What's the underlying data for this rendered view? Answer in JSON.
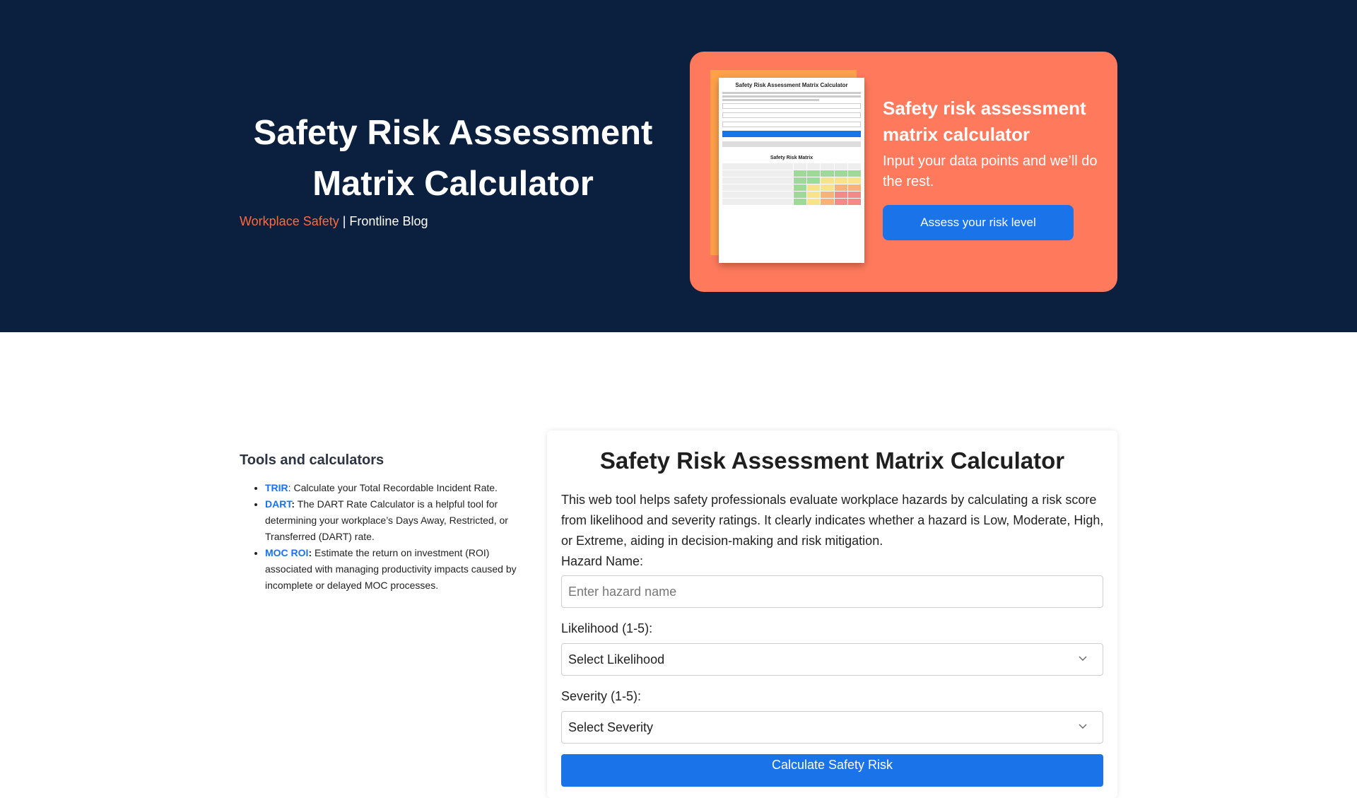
{
  "hero": {
    "title": "Safety Risk Assessment Matrix Calculator",
    "category": "Workplace Safety",
    "separator": " | ",
    "blog": "Frontline Blog"
  },
  "promo": {
    "doc_title": "Safety Risk Assessment Matrix Calculator",
    "doc_matrix_title": "Safety Risk Matrix",
    "title": "Safety risk assessment matrix calculator",
    "subtitle": "Input your data points and we’ll do the rest.",
    "button": "Assess your risk level"
  },
  "sidebar": {
    "heading": "Tools and calculators",
    "items": [
      {
        "link": "TRIR",
        "sep": ":",
        "text": " Calculate your Total Recordable Incident Rate."
      },
      {
        "link": "DART",
        "sep": ":",
        "text": " The DART Rate Calculator is a helpful tool for determining your workplace’s Days Away, Restricted, or Transferred (DART) rate."
      },
      {
        "link": "MOC ROI",
        "sep": ":",
        "text": " Estimate the return on investment (ROI) associated with managing productivity impacts caused by incomplete or delayed MOC processes."
      }
    ]
  },
  "calculator": {
    "title": "Safety Risk Assessment Matrix Calculator",
    "description": "This web tool helps safety professionals evaluate workplace hazards by calculating a risk score from likelihood and severity ratings. It clearly indicates whether a hazard is Low, Moderate, High, or Extreme, aiding in decision-making and risk mitigation.",
    "hazard_label": "Hazard Name:",
    "hazard_placeholder": "Enter hazard name",
    "likelihood_label": "Likelihood (1-5):",
    "likelihood_value": "Select Likelihood",
    "severity_label": "Severity (1-5):",
    "severity_value": "Select Severity",
    "button": "Calculate Safety Risk"
  },
  "colors": {
    "hero_bg": "#0b1f3f",
    "accent_orange": "#ff6a3d",
    "promo_bg": "#ff7a5c",
    "link_blue": "#1a73e8"
  }
}
